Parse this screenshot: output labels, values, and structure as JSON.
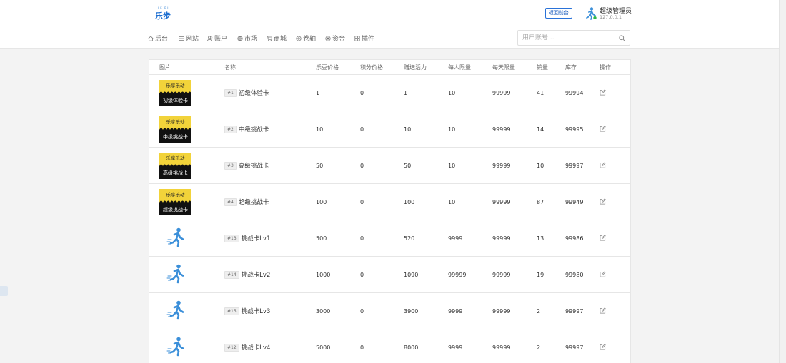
{
  "header": {
    "logo_small": "LE BU",
    "logo_big": "乐步",
    "back_label": "返回前台",
    "user_name": "超级管理员",
    "user_ip": "127.0.0.1"
  },
  "nav": [
    {
      "label": "后台",
      "icon": "home-icon"
    },
    {
      "label": "网站",
      "icon": "menu-icon"
    },
    {
      "label": "账户",
      "icon": "users-icon"
    },
    {
      "label": "市场",
      "icon": "globe-icon"
    },
    {
      "label": "商城",
      "icon": "cart-icon"
    },
    {
      "label": "卷轴",
      "icon": "scroll-icon"
    },
    {
      "label": "资金",
      "icon": "coin-icon"
    },
    {
      "label": "插件",
      "icon": "plugin-icon"
    }
  ],
  "search": {
    "placeholder": "用户账号..."
  },
  "columns": [
    "图片",
    "名称",
    "乐豆价格",
    "积分价格",
    "赠送活力",
    "每人限量",
    "每天限量",
    "销量",
    "库存",
    "操作"
  ],
  "rows": [
    {
      "image": "card",
      "card_text": "初级体验卡",
      "id": "#1",
      "name": "初级体验卡",
      "bean_price": "1",
      "point_price": "0",
      "vitality": "1",
      "per_person": "10",
      "per_day": "99999",
      "sales": "41",
      "stock": "99994"
    },
    {
      "image": "card",
      "card_text": "中级挑战卡",
      "id": "#2",
      "name": "中级挑战卡",
      "bean_price": "10",
      "point_price": "0",
      "vitality": "10",
      "per_person": "10",
      "per_day": "99999",
      "sales": "14",
      "stock": "99995"
    },
    {
      "image": "card",
      "card_text": "高级挑战卡",
      "id": "#3",
      "name": "高级挑战卡",
      "bean_price": "50",
      "point_price": "0",
      "vitality": "50",
      "per_person": "10",
      "per_day": "99999",
      "sales": "10",
      "stock": "99997"
    },
    {
      "image": "card",
      "card_text": "超级挑战卡",
      "id": "#4",
      "name": "超级挑战卡",
      "bean_price": "100",
      "point_price": "0",
      "vitality": "100",
      "per_person": "10",
      "per_day": "99999",
      "sales": "87",
      "stock": "99949"
    },
    {
      "image": "runner",
      "id": "#13",
      "name": "挑战卡Lv1",
      "bean_price": "500",
      "point_price": "0",
      "vitality": "520",
      "per_person": "9999",
      "per_day": "99999",
      "sales": "13",
      "stock": "99986"
    },
    {
      "image": "runner",
      "id": "#14",
      "name": "挑战卡Lv2",
      "bean_price": "1000",
      "point_price": "0",
      "vitality": "1090",
      "per_person": "99999",
      "per_day": "99999",
      "sales": "19",
      "stock": "99980"
    },
    {
      "image": "runner",
      "id": "#15",
      "name": "挑战卡Lv3",
      "bean_price": "3000",
      "point_price": "0",
      "vitality": "3900",
      "per_person": "9999",
      "per_day": "99999",
      "sales": "2",
      "stock": "99997"
    },
    {
      "image": "runner",
      "id": "#12",
      "name": "挑战卡Lv4",
      "bean_price": "5000",
      "point_price": "0",
      "vitality": "8000",
      "per_person": "9999",
      "per_day": "99999",
      "sales": "2",
      "stock": "99997"
    }
  ],
  "card_top_text": "乐享乐动",
  "colors": {
    "card_yellow": "#f2d33a",
    "runner_blue": "#3b8fd9",
    "accent": "#2a72d8"
  }
}
